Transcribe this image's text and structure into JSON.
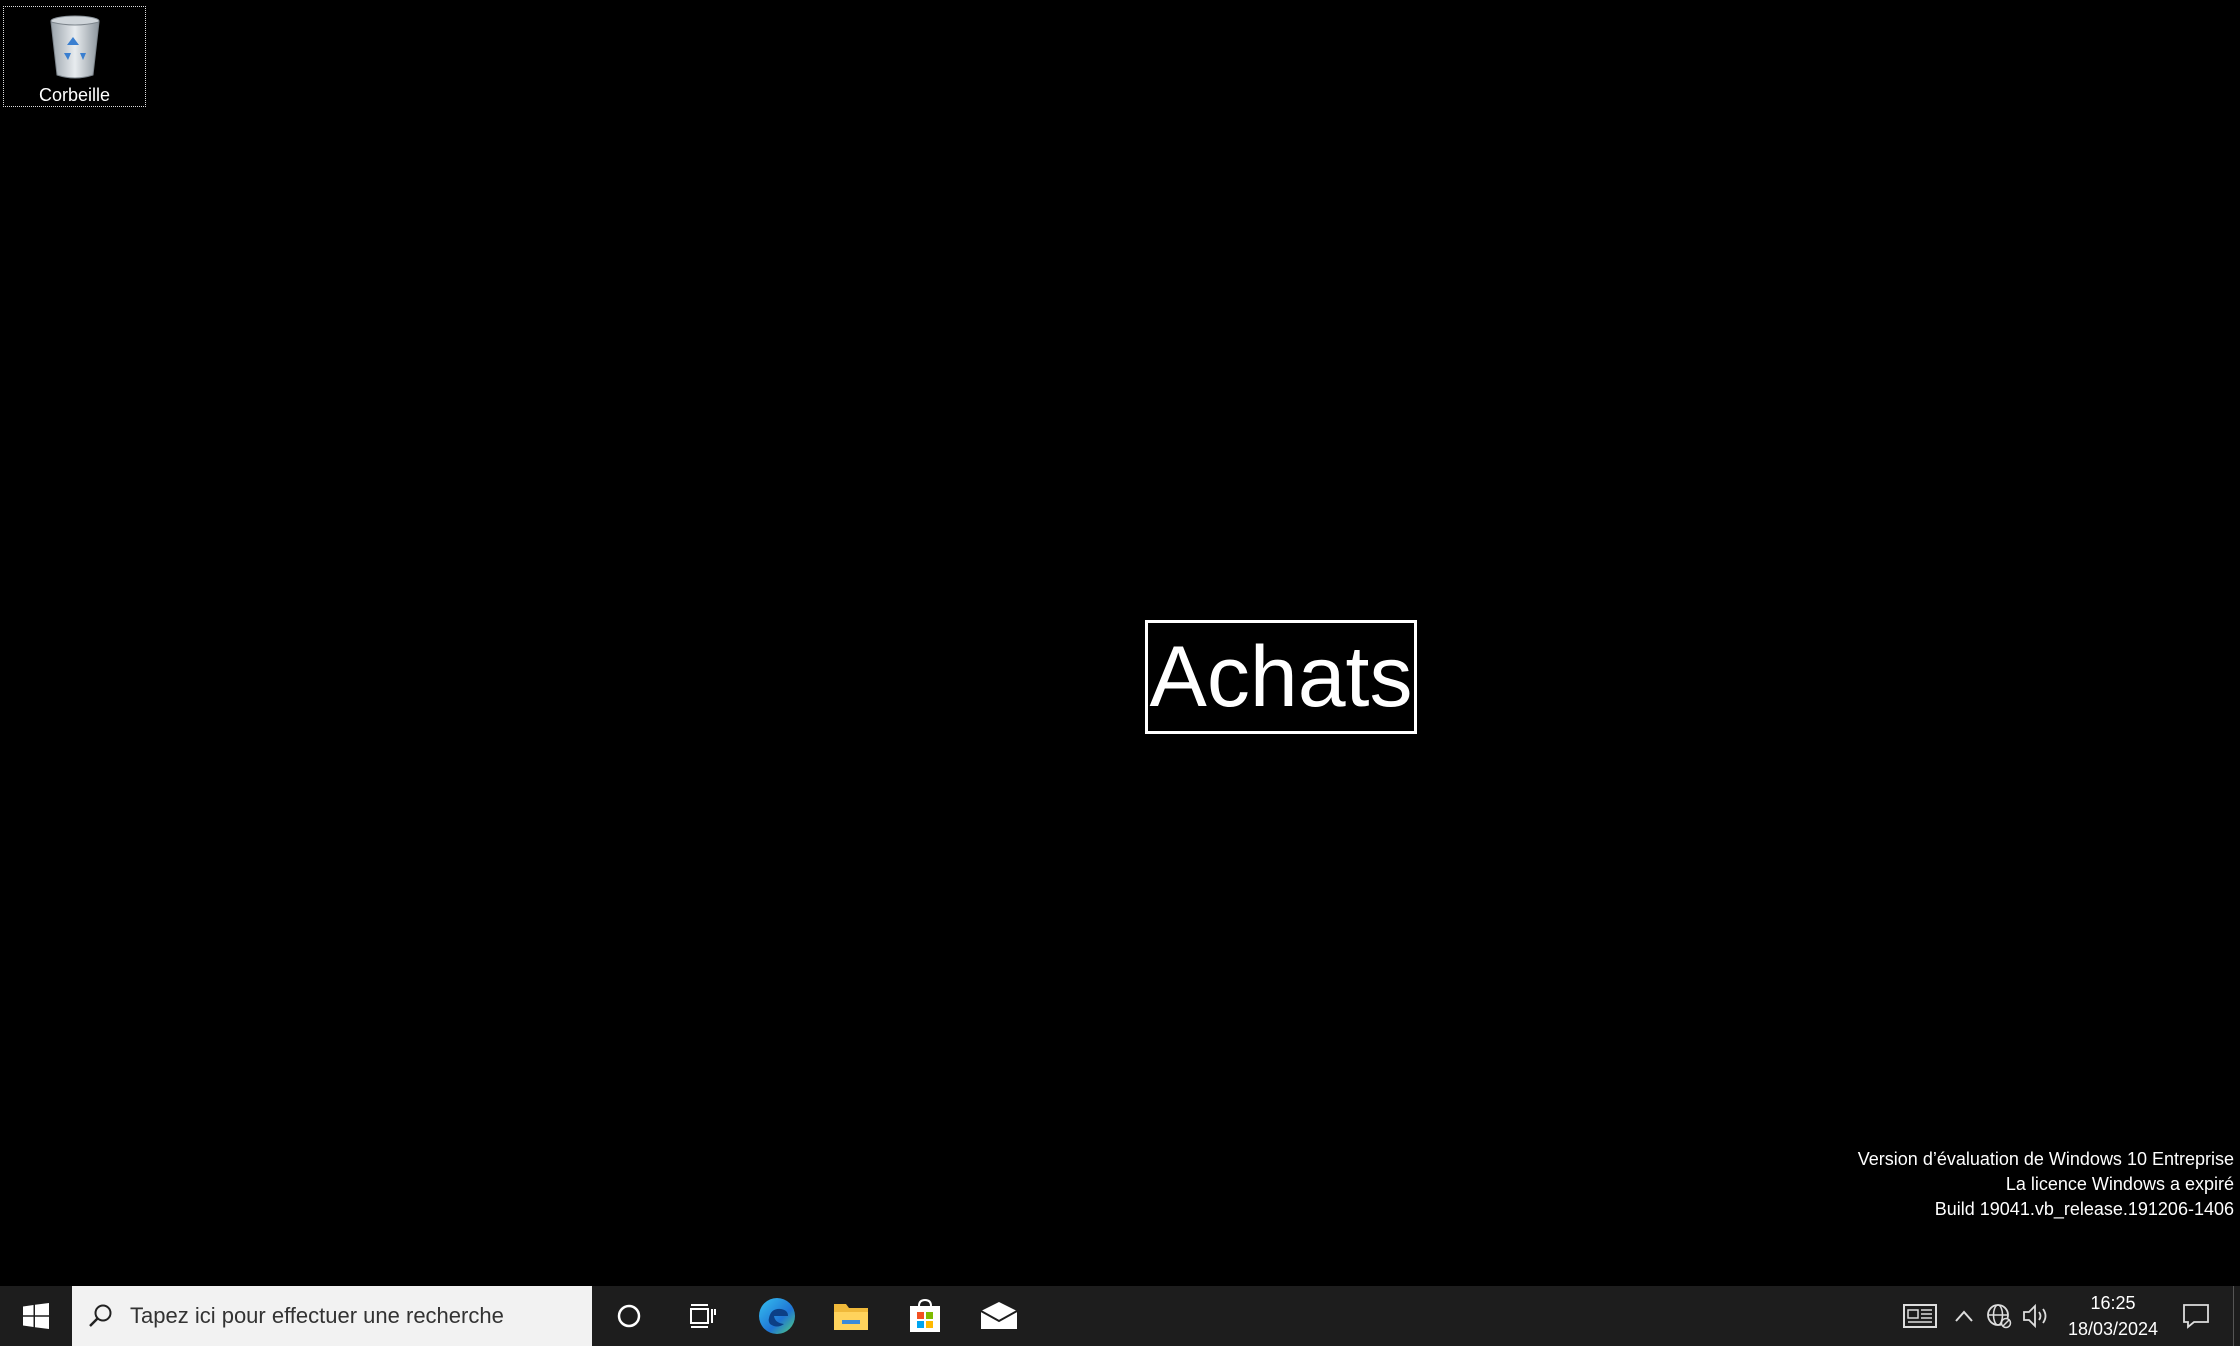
{
  "desktop": {
    "icons": [
      {
        "label": "Corbeille",
        "icon": "recycle-bin-icon"
      }
    ],
    "center_text": "Achats",
    "watermark": {
      "line1": "Version d’évaluation de Windows 10 Entreprise",
      "line2": "La licence Windows a expiré",
      "line3": "Build 19041.vb_release.191206-1406"
    }
  },
  "taskbar": {
    "search_placeholder": "Tapez ici pour effectuer une recherche",
    "pinned": [
      "cortana-icon",
      "task-view-icon",
      "edge-icon",
      "file-explorer-icon",
      "store-icon",
      "mail-icon"
    ],
    "tray": {
      "time": "16:25",
      "date": "18/03/2024"
    }
  },
  "colors": {
    "desktop_bg": "#000000",
    "taskbar_bg": "#1d1d1d",
    "search_bg": "#f2f2f2"
  }
}
